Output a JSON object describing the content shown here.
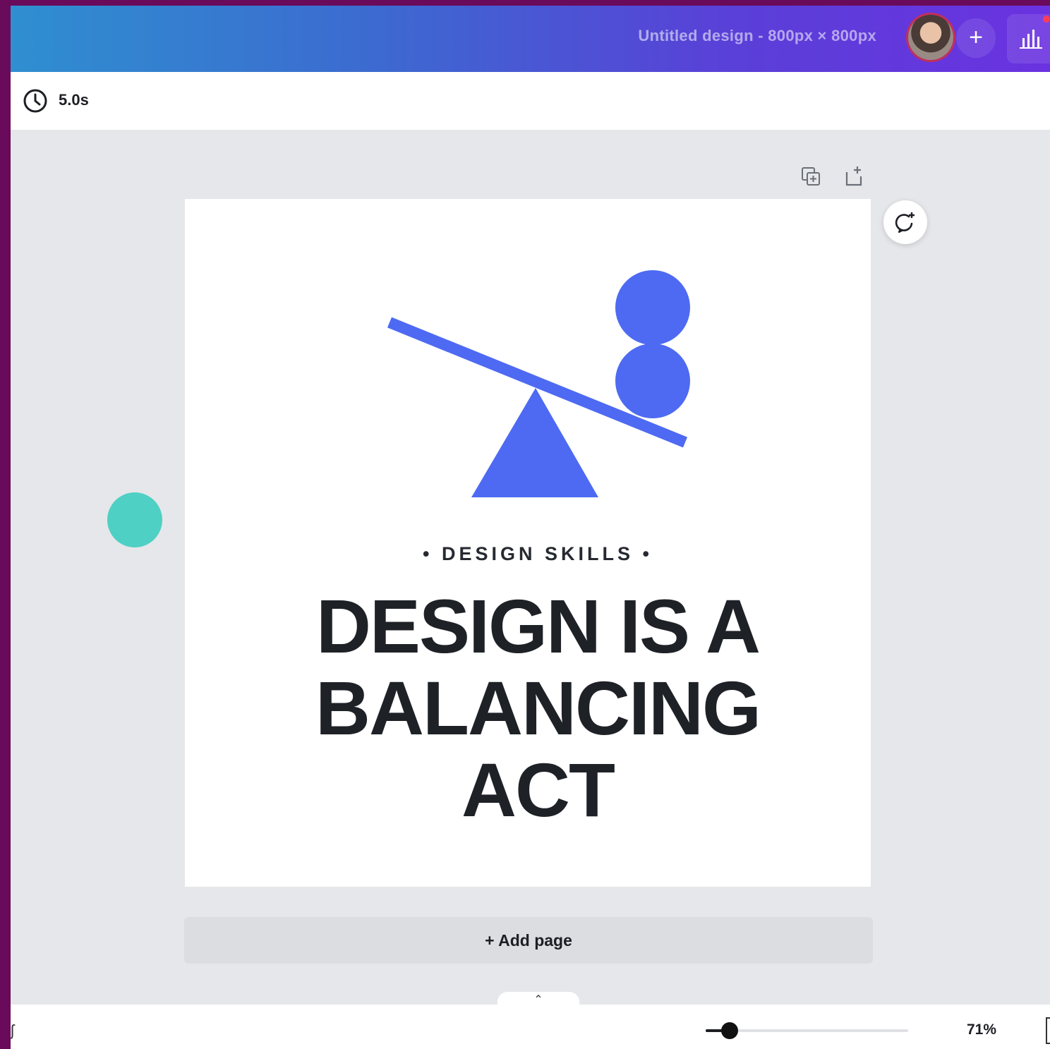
{
  "header": {
    "doc_title": "Untitled design - 800px × 800px",
    "avatar_label": "user avatar",
    "add_label": "+",
    "stats_icon": "bar-chart-icon"
  },
  "timing": {
    "duration": "5.0s",
    "icon": "clock-icon"
  },
  "canvas_tools": {
    "duplicate_icon": "duplicate-page-icon",
    "add_icon": "add-page-icon",
    "refresh_icon": "comment-add-icon"
  },
  "design": {
    "kicker": "• DESIGN SKILLS •",
    "headline": [
      "DESIGN IS A",
      "BALANCING",
      "ACT"
    ],
    "accent_color": "#4e6af2",
    "teal_color": "#4fd0c4"
  },
  "add_page": {
    "label": "+ Add page"
  },
  "footer": {
    "collapse_glyph": "⌃",
    "zoom_label": "71%",
    "zoom_value": 0.12
  }
}
